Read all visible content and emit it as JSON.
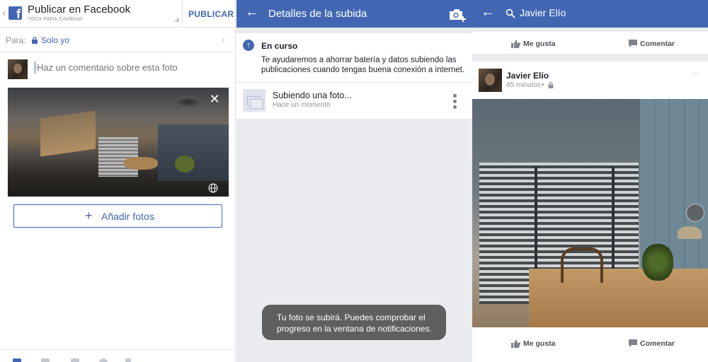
{
  "composer": {
    "title": "Publicar en Facebook",
    "subtitle": "TOCA PARA CAMBIAR",
    "publish_label": "PUBLICAR",
    "audience_label": "Para:",
    "audience_value": "Solo yo",
    "comment_placeholder": "Haz un comentario sobre esta foto",
    "add_photos_label": "Añadir fotos"
  },
  "upload_details": {
    "title": "Detalles de la subida",
    "status_title": "En curso",
    "status_message": "Te ayudaremos a ahorrar batería y datos subiendo las publicaciones cuando tengas buena conexión a internet.",
    "item_title": "Subiendo una foto...",
    "item_time": "Hace un momento",
    "toast": "Tu foto se subirá. Puedes comprobar el progreso en la ventana de notificaciones."
  },
  "feed": {
    "search_text": "Javier Elío",
    "like_label": "Me gusta",
    "comment_label": "Comentar",
    "post": {
      "author": "Javier Elío",
      "time": "45 minutos",
      "separator": "•"
    }
  },
  "colors": {
    "brand": "#4267b2",
    "background": "#e9ebee",
    "toast": "#5f5f5f"
  },
  "icons": [
    "facebook-logo",
    "lock-icon",
    "chevron-right-icon",
    "close-icon",
    "globe-icon",
    "plus-icon",
    "back-arrow-icon",
    "camera-plus-icon",
    "upload-arrow-icon",
    "photos-icon",
    "more-vert-icon",
    "search-icon",
    "like-icon",
    "comment-icon",
    "chevron-down-icon",
    "360-icon"
  ]
}
